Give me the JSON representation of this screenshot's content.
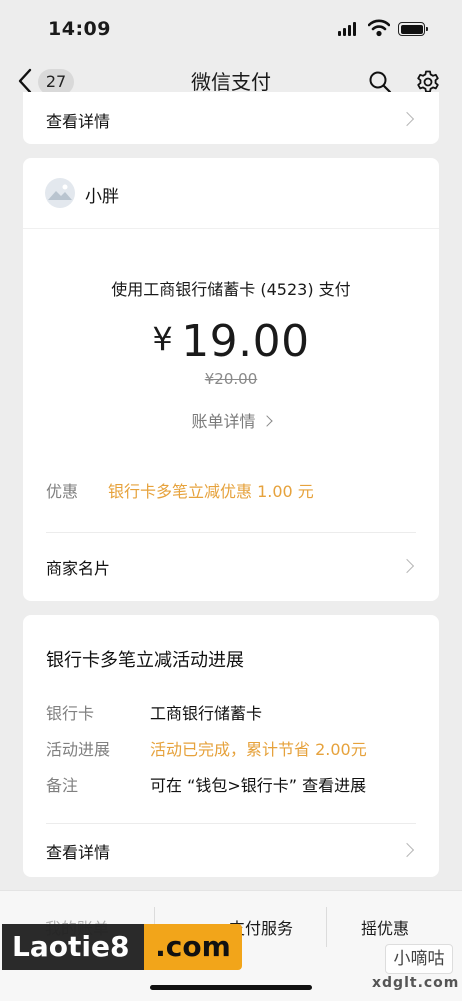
{
  "status_bar": {
    "time": "14:09"
  },
  "nav": {
    "back_count": "27",
    "title": "微信支付"
  },
  "top_card": {
    "view_details": "查看详情"
  },
  "payment_card": {
    "merchant": "小胖",
    "pay_method": "使用工商银行储蓄卡 (4523) 支付",
    "currency": "¥",
    "amount": "19.00",
    "original_amount": "¥20.00",
    "bill_details": "账单详情",
    "discount_label": "优惠",
    "discount_value": "银行卡多笔立减优惠 1.00 元",
    "merchant_card": "商家名片"
  },
  "campaign_card": {
    "title": "银行卡多笔立减活动进展",
    "rows": [
      {
        "label": "银行卡",
        "value": "工商银行储蓄卡"
      },
      {
        "label": "活动进展",
        "value": "活动已完成，累计节省 2.00元"
      },
      {
        "label": "备注",
        "value": "可在 “钱包>银行卡” 查看进展"
      }
    ],
    "view_details": "查看详情"
  },
  "tab_bar": {
    "tabs": [
      "我的账单",
      "支付服务",
      "摇优惠"
    ]
  },
  "watermarks": {
    "site_a_dark": "Laotie8",
    "site_a_orange": ".com",
    "site_b_badge": "小嘀咕",
    "site_b_url": "xdglt.com"
  },
  "colors": {
    "accent_orange": "#e6a23c",
    "background": "#ededed",
    "card": "#ffffff"
  }
}
